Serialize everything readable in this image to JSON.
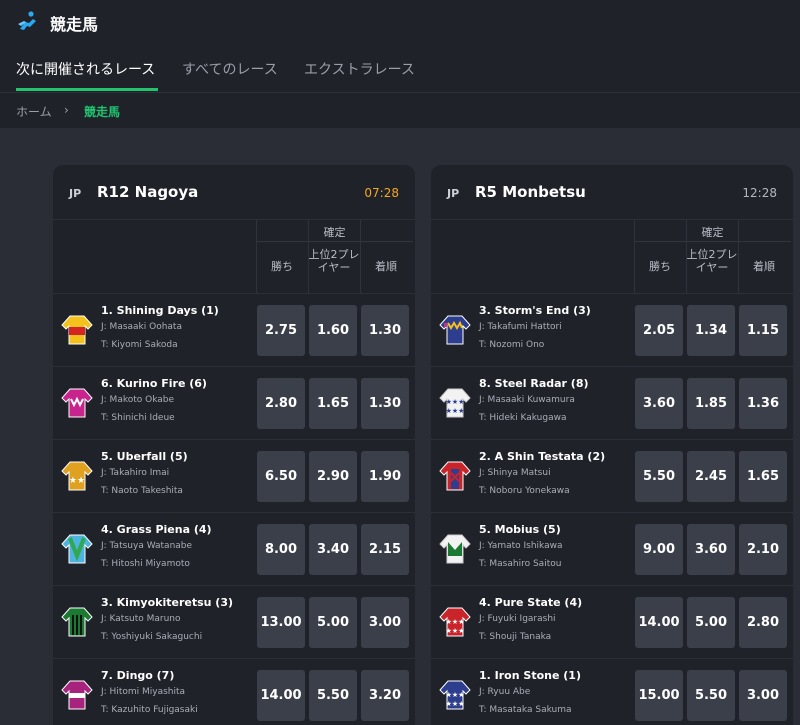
{
  "header": {
    "title": "競走馬",
    "icon": "horse-racing-icon",
    "accent_color": "#21c36e"
  },
  "tabs": [
    {
      "label": "次に開催されるレース",
      "active": true
    },
    {
      "label": "すべてのレース",
      "active": false
    },
    {
      "label": "エクストラレース",
      "active": false
    }
  ],
  "breadcrumb": {
    "home": "ホーム",
    "separator": "›",
    "current": "競走馬"
  },
  "columns": {
    "confirmed": "確定",
    "win": "勝ち",
    "place": "上位2プレイヤー",
    "finish": "着順"
  },
  "races": [
    {
      "country": "JP",
      "name": "R12 Nagoya",
      "time": "07:28",
      "time_color": "#f5a623",
      "runners": [
        {
          "name": "1. Shining Days (1)",
          "jockey": "J: Masaaki Oohata",
          "trainer": "T: Kiyomi Sakoda",
          "win": "2.75",
          "place": "1.60",
          "finish": "1.30"
        },
        {
          "name": "6. Kurino Fire (6)",
          "jockey": "J: Makoto Okabe",
          "trainer": "T: Shinichi Ideue",
          "win": "2.80",
          "place": "1.65",
          "finish": "1.30"
        },
        {
          "name": "5. Uberfall (5)",
          "jockey": "J: Takahiro Imai",
          "trainer": "T: Naoto Takeshita",
          "win": "6.50",
          "place": "2.90",
          "finish": "1.90"
        },
        {
          "name": "4. Grass Piena (4)",
          "jockey": "J: Tatsuya Watanabe",
          "trainer": "T: Hitoshi Miyamoto",
          "win": "8.00",
          "place": "3.40",
          "finish": "2.15"
        },
        {
          "name": "3. Kimyokiteretsu (3)",
          "jockey": "J: Katsuto Maruno",
          "trainer": "T: Yoshiyuki Sakaguchi",
          "win": "13.00",
          "place": "5.00",
          "finish": "3.00"
        },
        {
          "name": "7. Dingo (7)",
          "jockey": "J: Hitomi Miyashita",
          "trainer": "T: Kazuhito Fujigasaki",
          "win": "14.00",
          "place": "5.50",
          "finish": "3.20"
        }
      ]
    },
    {
      "country": "JP",
      "name": "R5 Monbetsu",
      "time": "12:28",
      "time_color": "#b3b7c0",
      "runners": [
        {
          "name": "3. Storm's End (3)",
          "jockey": "J: Takafumi Hattori",
          "trainer": "T: Nozomi Ono",
          "win": "2.05",
          "place": "1.34",
          "finish": "1.15"
        },
        {
          "name": "8. Steel Radar (8)",
          "jockey": "J: Masaaki Kuwamura",
          "trainer": "T: Hideki Kakugawa",
          "win": "3.60",
          "place": "1.85",
          "finish": "1.36"
        },
        {
          "name": "2. A Shin Testata (2)",
          "jockey": "J: Shinya Matsui",
          "trainer": "T: Noboru Yonekawa",
          "win": "5.50",
          "place": "2.45",
          "finish": "1.65"
        },
        {
          "name": "5. Mobius (5)",
          "jockey": "J: Yamato Ishikawa",
          "trainer": "T: Masahiro Saitou",
          "win": "9.00",
          "place": "3.60",
          "finish": "2.10"
        },
        {
          "name": "4. Pure State (4)",
          "jockey": "J: Fuyuki Igarashi",
          "trainer": "T: Shouji Tanaka",
          "win": "14.00",
          "place": "5.00",
          "finish": "2.80"
        },
        {
          "name": "1. Iron Stone (1)",
          "jockey": "J: Ryuu Abe",
          "trainer": "T: Masataka Sakuma",
          "win": "15.00",
          "place": "5.50",
          "finish": "3.00"
        }
      ]
    }
  ]
}
